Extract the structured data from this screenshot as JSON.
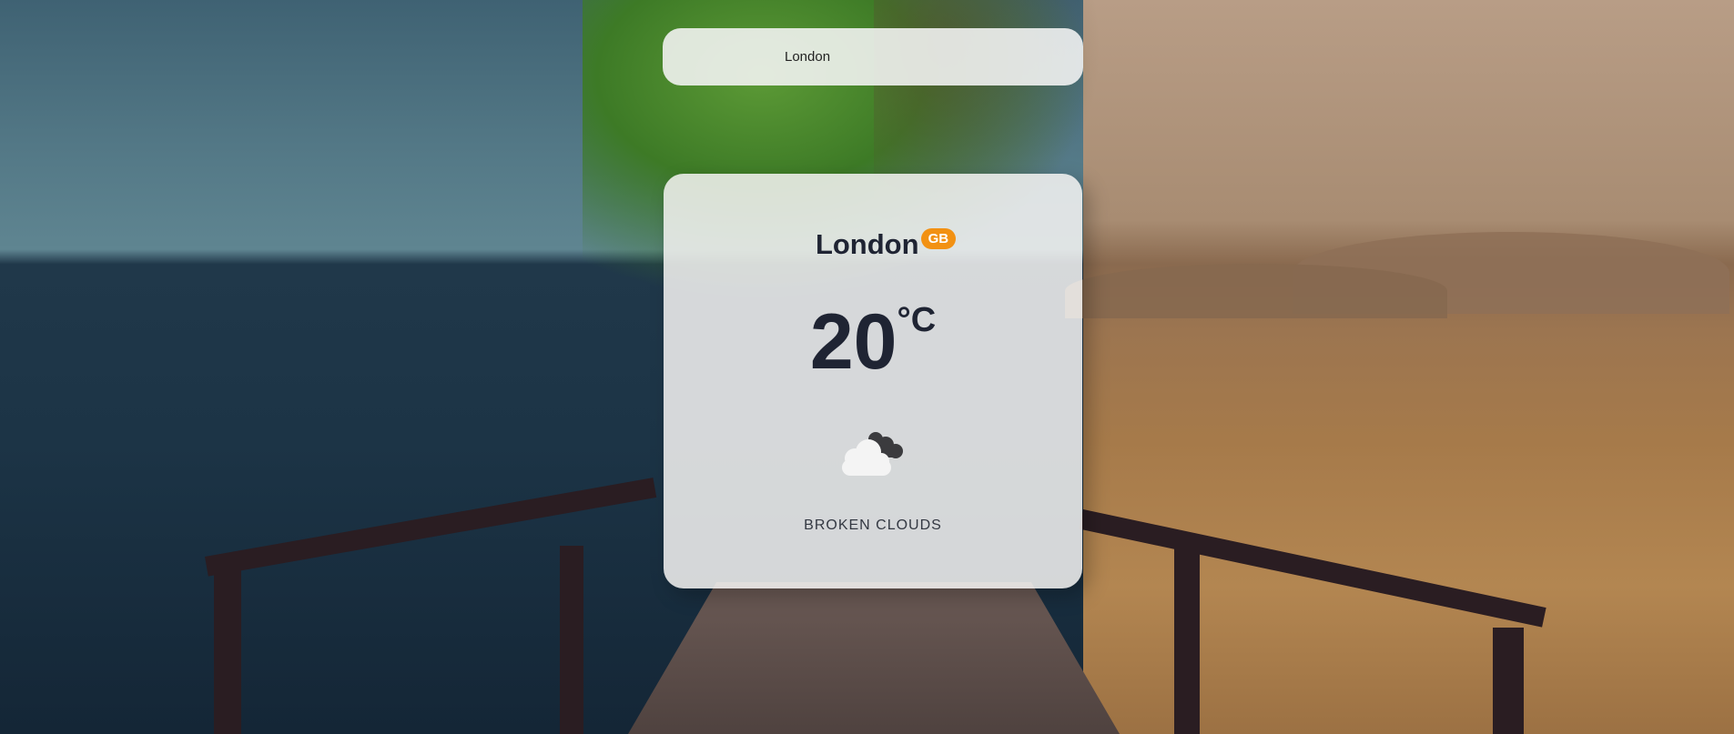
{
  "search": {
    "value": "London",
    "placeholder": ""
  },
  "weather": {
    "city": "London",
    "country": "GB",
    "temperature": "20",
    "unit": "°C",
    "description": "BROKEN CLOUDS",
    "icon": "broken-clouds-icon"
  },
  "colors": {
    "badge": "#f29113",
    "text_dark": "#1f2433",
    "card_bg": "#f5f3f2"
  }
}
